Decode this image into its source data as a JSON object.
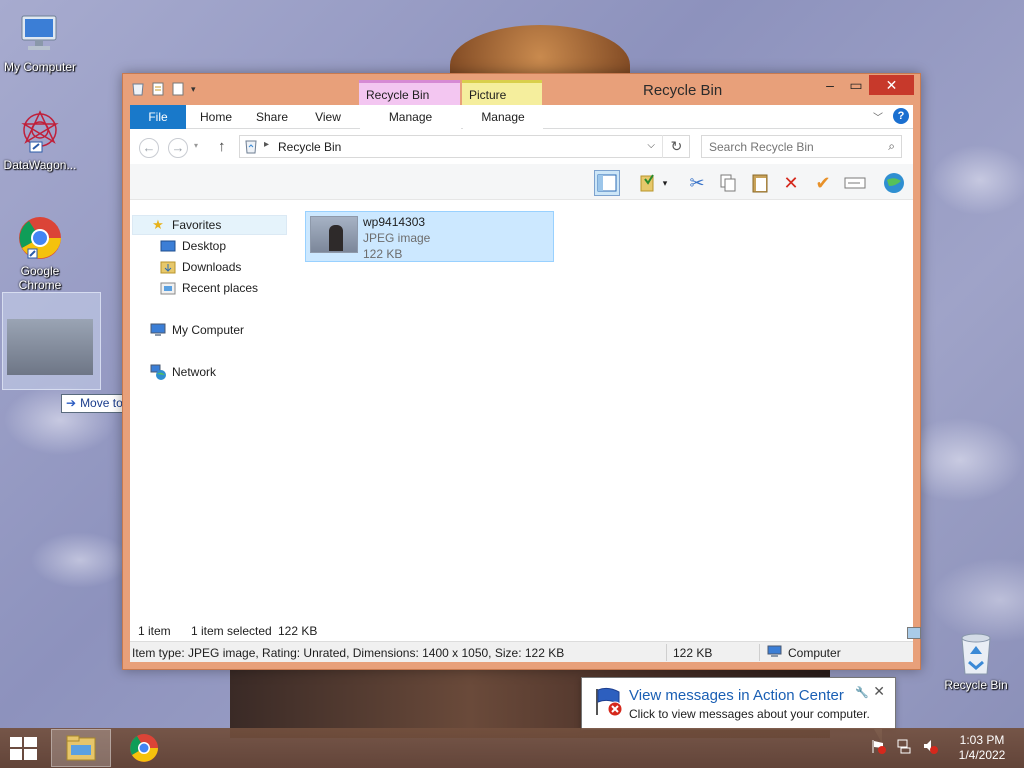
{
  "desktop": {
    "icons": [
      {
        "label": "My Computer",
        "icon": "computer-icon"
      },
      {
        "label": "DataWagon...",
        "icon": "datawagon-icon"
      },
      {
        "label": "Google Chrome",
        "icon": "chrome-icon"
      },
      {
        "label": "Recycle Bin",
        "icon": "recycle-bin-icon"
      }
    ],
    "drag_tooltip": "Move to Desktop"
  },
  "window": {
    "title": "Recycle Bin",
    "contextual_tabs": {
      "recycle_bin_tools": "Recycle Bin Tools",
      "picture_tools": "Picture Tools"
    },
    "ribbon_tabs": [
      "File",
      "Home",
      "Share",
      "View",
      "Manage",
      "Manage"
    ],
    "address": {
      "crumb": "Recycle Bin"
    },
    "search": {
      "placeholder": "Search Recycle Bin"
    },
    "nav": {
      "favorites": "Favorites",
      "favorites_items": [
        "Desktop",
        "Downloads",
        "Recent places"
      ],
      "computer": "My Computer",
      "network": "Network"
    },
    "files": [
      {
        "name": "wp9414303",
        "type": "JPEG image",
        "size": "122 KB"
      }
    ],
    "status": {
      "count": "1 item",
      "selected": "1 item selected",
      "selected_size": "122 KB"
    },
    "details": {
      "info": "Item type: JPEG image, Rating: Unrated, Dimensions: 1400 x 1050, Size: 122 KB",
      "size": "122 KB",
      "location": "Computer"
    }
  },
  "notification": {
    "title": "View messages in Action Center",
    "message": "Click to view messages about your computer."
  },
  "taskbar": {
    "time": "1:03 PM",
    "date": "1/4/2022"
  },
  "colors": {
    "window_frame": "#e8a07a",
    "file_tab": "#1979ca",
    "selection": "#cce8ff",
    "close_button": "#c7392b"
  }
}
